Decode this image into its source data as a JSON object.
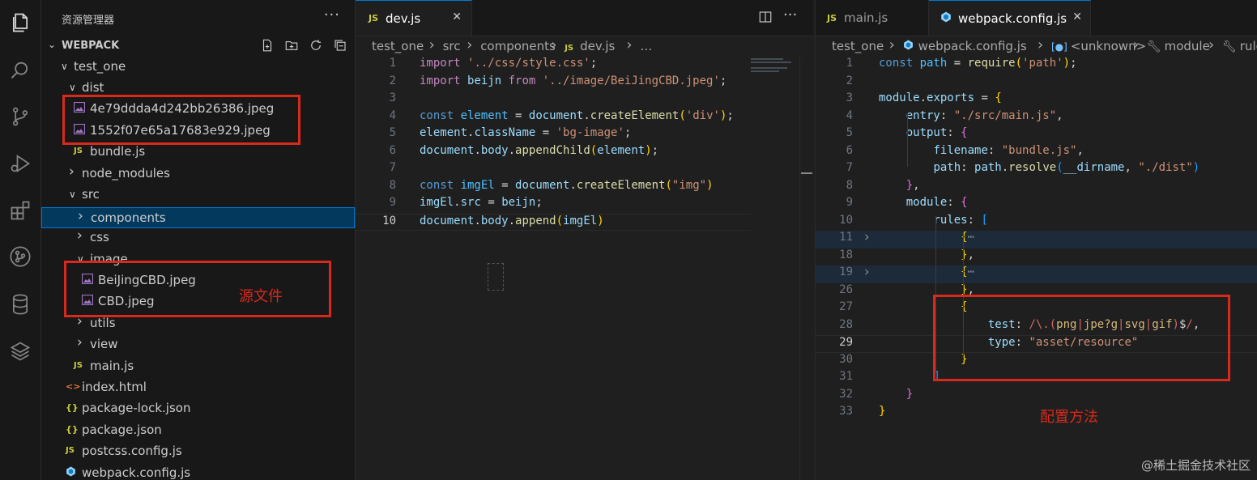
{
  "activity_bar": {
    "items": [
      {
        "name": "files-icon"
      },
      {
        "name": "search-icon"
      },
      {
        "name": "source-control-icon"
      },
      {
        "name": "run-debug-icon"
      },
      {
        "name": "extensions-icon"
      },
      {
        "name": "git-graph-icon"
      },
      {
        "name": "database-icon"
      },
      {
        "name": "layers-icon"
      }
    ]
  },
  "sidebar": {
    "title": "资源管理器",
    "more": "···",
    "section": "WEBPACK",
    "tree": [
      {
        "label": "test_one",
        "type": "folder-open"
      },
      {
        "label": "dist",
        "type": "folder-open"
      },
      {
        "label": "4e79ddda4d242bb26386.jpeg",
        "type": "image"
      },
      {
        "label": "1552f07e65a17683e929.jpeg",
        "type": "image"
      },
      {
        "label": "bundle.js",
        "type": "js"
      },
      {
        "label": "node_modules",
        "type": "folder"
      },
      {
        "label": "src",
        "type": "folder-open"
      },
      {
        "label": "components",
        "type": "folder"
      },
      {
        "label": "css",
        "type": "folder"
      },
      {
        "label": "image",
        "type": "folder-open"
      },
      {
        "label": "BeiJingCBD.jpeg",
        "type": "image"
      },
      {
        "label": "CBD.jpeg",
        "type": "image"
      },
      {
        "label": "utils",
        "type": "folder"
      },
      {
        "label": "view",
        "type": "folder"
      },
      {
        "label": "main.js",
        "type": "js"
      },
      {
        "label": "index.html",
        "type": "html"
      },
      {
        "label": "package-lock.json",
        "type": "json"
      },
      {
        "label": "package.json",
        "type": "json"
      },
      {
        "label": "postcss.config.js",
        "type": "js"
      },
      {
        "label": "webpack.config.js",
        "type": "webpack"
      }
    ],
    "annotation": "源文件"
  },
  "editor1": {
    "tab": {
      "icon": "JS",
      "label": "dev.js",
      "close": "✕"
    },
    "breadcrumb": [
      "test_one",
      "src",
      "components",
      "dev.js",
      "…"
    ],
    "breadcrumb_icon": "JS",
    "lines": [
      {
        "n": "1",
        "tokens": [
          [
            "kw2",
            "import "
          ],
          [
            "str",
            "'../css/style.css'"
          ],
          [
            "plain",
            ";"
          ]
        ]
      },
      {
        "n": "2",
        "tokens": [
          [
            "kw2",
            "import "
          ],
          [
            "var",
            "beijn"
          ],
          [
            "kw2",
            " from "
          ],
          [
            "str",
            "'../image/BeiJingCBD.jpeg'"
          ],
          [
            "plain",
            ";"
          ]
        ]
      },
      {
        "n": "3",
        "tokens": []
      },
      {
        "n": "4",
        "tokens": [
          [
            "kw",
            "const "
          ],
          [
            "obj",
            "element"
          ],
          [
            "plain",
            " = "
          ],
          [
            "var",
            "document"
          ],
          [
            "plain",
            "."
          ],
          [
            "fn",
            "createElement"
          ],
          [
            "br1",
            "("
          ],
          [
            "str",
            "'div'"
          ],
          [
            "br1",
            ")"
          ],
          [
            "plain",
            ";"
          ]
        ]
      },
      {
        "n": "5",
        "tokens": [
          [
            "var",
            "element"
          ],
          [
            "plain",
            "."
          ],
          [
            "var",
            "className"
          ],
          [
            "plain",
            " = "
          ],
          [
            "str",
            "'bg-image'"
          ],
          [
            "plain",
            ";"
          ]
        ]
      },
      {
        "n": "6",
        "tokens": [
          [
            "var",
            "document"
          ],
          [
            "plain",
            "."
          ],
          [
            "var",
            "body"
          ],
          [
            "plain",
            "."
          ],
          [
            "fn",
            "appendChild"
          ],
          [
            "br1",
            "("
          ],
          [
            "var",
            "element"
          ],
          [
            "br1",
            ")"
          ],
          [
            "plain",
            ";"
          ]
        ]
      },
      {
        "n": "7",
        "tokens": []
      },
      {
        "n": "8",
        "tokens": [
          [
            "kw",
            "const "
          ],
          [
            "obj",
            "imgEl"
          ],
          [
            "plain",
            " = "
          ],
          [
            "var",
            "document"
          ],
          [
            "plain",
            "."
          ],
          [
            "fn",
            "createElement"
          ],
          [
            "br1",
            "("
          ],
          [
            "str",
            "\"img\""
          ],
          [
            "br1",
            ")"
          ]
        ]
      },
      {
        "n": "9",
        "tokens": [
          [
            "var",
            "imgEl"
          ],
          [
            "plain",
            "."
          ],
          [
            "var",
            "src"
          ],
          [
            "plain",
            " = "
          ],
          [
            "var",
            "beijn"
          ],
          [
            "plain",
            ";"
          ]
        ]
      },
      {
        "n": "10",
        "tokens": [
          [
            "var",
            "document"
          ],
          [
            "plain",
            "."
          ],
          [
            "var",
            "body"
          ],
          [
            "plain",
            "."
          ],
          [
            "fn",
            "append"
          ],
          [
            "br1",
            "("
          ],
          [
            "var",
            "imgEl"
          ],
          [
            "br1",
            ")"
          ]
        ]
      }
    ]
  },
  "editor2": {
    "tabs": [
      {
        "icon": "JS",
        "label": "main.js"
      },
      {
        "icon": "webpack",
        "label": "webpack.config.js",
        "close": "✕"
      }
    ],
    "breadcrumb": [
      "test_one",
      "webpack.config.js",
      "<unknown>",
      "module",
      "rule"
    ],
    "lines": [
      {
        "n": "1",
        "tokens": [
          [
            "kw",
            "const "
          ],
          [
            "obj",
            "path"
          ],
          [
            "plain",
            " = "
          ],
          [
            "fn",
            "require"
          ],
          [
            "br1",
            "("
          ],
          [
            "str",
            "'path'"
          ],
          [
            "br1",
            ")"
          ],
          [
            "plain",
            ";"
          ]
        ]
      },
      {
        "n": "2",
        "tokens": []
      },
      {
        "n": "3",
        "tokens": [
          [
            "var",
            "module"
          ],
          [
            "plain",
            "."
          ],
          [
            "var",
            "exports"
          ],
          [
            "plain",
            " = "
          ],
          [
            "br1",
            "{"
          ]
        ]
      },
      {
        "n": "4",
        "tokens": [
          [
            "plain",
            "    "
          ],
          [
            "var",
            "entry"
          ],
          [
            "plain",
            ": "
          ],
          [
            "str",
            "\"./src/main.js\""
          ],
          [
            "plain",
            ","
          ]
        ]
      },
      {
        "n": "5",
        "tokens": [
          [
            "plain",
            "    "
          ],
          [
            "var",
            "output"
          ],
          [
            "plain",
            ": "
          ],
          [
            "br2",
            "{"
          ]
        ]
      },
      {
        "n": "6",
        "tokens": [
          [
            "plain",
            "        "
          ],
          [
            "var",
            "filename"
          ],
          [
            "plain",
            ": "
          ],
          [
            "str",
            "\"bundle.js\""
          ],
          [
            "plain",
            ","
          ]
        ]
      },
      {
        "n": "7",
        "tokens": [
          [
            "plain",
            "        "
          ],
          [
            "var",
            "path"
          ],
          [
            "plain",
            ": "
          ],
          [
            "var",
            "path"
          ],
          [
            "plain",
            "."
          ],
          [
            "fn",
            "resolve"
          ],
          [
            "br3",
            "("
          ],
          [
            "var",
            "__dirname"
          ],
          [
            "plain",
            ", "
          ],
          [
            "str",
            "\"./dist\""
          ],
          [
            "br3",
            ")"
          ]
        ]
      },
      {
        "n": "8",
        "tokens": [
          [
            "plain",
            "    "
          ],
          [
            "br2",
            "}"
          ],
          [
            "plain",
            ","
          ]
        ]
      },
      {
        "n": "9",
        "tokens": [
          [
            "plain",
            "    "
          ],
          [
            "var",
            "module"
          ],
          [
            "plain",
            ": "
          ],
          [
            "br2",
            "{"
          ]
        ]
      },
      {
        "n": "10",
        "tokens": [
          [
            "plain",
            "        "
          ],
          [
            "var",
            "rules"
          ],
          [
            "plain",
            ": "
          ],
          [
            "br3",
            "["
          ]
        ]
      },
      {
        "n": "11",
        "tokens": [
          [
            "plain",
            "            "
          ],
          [
            "br1",
            "{"
          ],
          [
            "fold",
            "⋯"
          ]
        ],
        "fold": true
      },
      {
        "n": "18",
        "tokens": [
          [
            "plain",
            "            "
          ],
          [
            "br1",
            "}"
          ],
          [
            "plain",
            ","
          ]
        ]
      },
      {
        "n": "19",
        "tokens": [
          [
            "plain",
            "            "
          ],
          [
            "br1",
            "{"
          ],
          [
            "fold",
            "⋯"
          ]
        ],
        "fold": true
      },
      {
        "n": "26",
        "tokens": [
          [
            "plain",
            "            "
          ],
          [
            "br1",
            "}"
          ],
          [
            "plain",
            ","
          ]
        ]
      },
      {
        "n": "27",
        "tokens": [
          [
            "plain",
            "            "
          ],
          [
            "br1",
            "{"
          ]
        ]
      },
      {
        "n": "28",
        "tokens": [
          [
            "plain",
            "                "
          ],
          [
            "var",
            "test"
          ],
          [
            "plain",
            ": "
          ],
          [
            "rx",
            "/\\.("
          ],
          [
            "rxe",
            "png"
          ],
          [
            "rx",
            "|"
          ],
          [
            "rxe",
            "jpe?g"
          ],
          [
            "rx",
            "|"
          ],
          [
            "rxe",
            "svg"
          ],
          [
            "rx",
            "|"
          ],
          [
            "rxe",
            "gif"
          ],
          [
            "rx",
            ")"
          ],
          [
            "plain",
            "$"
          ],
          [
            "rx",
            "/"
          ],
          [
            "plain",
            ","
          ]
        ]
      },
      {
        "n": "29",
        "tokens": [
          [
            "plain",
            "                "
          ],
          [
            "var",
            "type"
          ],
          [
            "plain",
            ": "
          ],
          [
            "str",
            "\"asset/resource\""
          ]
        ]
      },
      {
        "n": "30",
        "tokens": [
          [
            "plain",
            "            "
          ],
          [
            "br1",
            "}"
          ]
        ]
      },
      {
        "n": "31",
        "tokens": [
          [
            "plain",
            "        "
          ],
          [
            "br3",
            "]"
          ]
        ]
      },
      {
        "n": "32",
        "tokens": [
          [
            "plain",
            "    "
          ],
          [
            "br2",
            "}"
          ]
        ]
      },
      {
        "n": "33",
        "tokens": [
          [
            "br1",
            "}"
          ]
        ]
      }
    ],
    "annotation": "配置方法"
  },
  "watermark": "@稀土掘金技术社区"
}
